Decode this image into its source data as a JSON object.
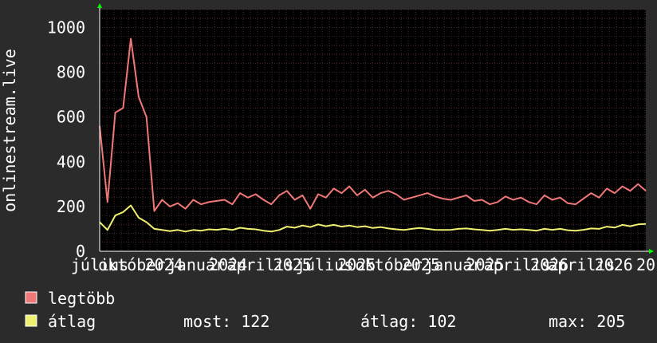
{
  "chart_data": {
    "type": "line",
    "ylabel": "onlinestream.live",
    "ylim": [
      0,
      1080
    ],
    "yticks": [
      0,
      200,
      400,
      600,
      800,
      1000
    ],
    "xticks": [
      "július",
      "október",
      "2024",
      "január",
      "2024",
      "április",
      "2025",
      "július",
      "2025",
      "október",
      "2025",
      "január",
      "2025",
      "április",
      "2026",
      "április",
      "2026",
      "20"
    ],
    "grid": true,
    "legend_placement": "bottom-left",
    "series": [
      {
        "name": "legtöbb",
        "color": "#f07878",
        "values": [
          560,
          220,
          620,
          640,
          950,
          690,
          600,
          180,
          230,
          200,
          215,
          190,
          230,
          210,
          220,
          225,
          230,
          210,
          260,
          240,
          255,
          230,
          210,
          250,
          270,
          230,
          250,
          190,
          255,
          240,
          280,
          260,
          290,
          250,
          275,
          240,
          260,
          270,
          255,
          230,
          240,
          250,
          260,
          245,
          235,
          230,
          240,
          250,
          225,
          230,
          210,
          220,
          245,
          230,
          240,
          220,
          210,
          250,
          230,
          240,
          215,
          210,
          235,
          260,
          240,
          280,
          260,
          290,
          270,
          300,
          270
        ]
      },
      {
        "name": "átlag",
        "color": "#f0f070",
        "values": [
          130,
          95,
          160,
          175,
          205,
          150,
          130,
          100,
          95,
          90,
          95,
          88,
          95,
          92,
          98,
          96,
          100,
          95,
          105,
          100,
          98,
          92,
          88,
          95,
          110,
          105,
          115,
          108,
          120,
          112,
          118,
          110,
          115,
          108,
          112,
          104,
          108,
          102,
          98,
          95,
          100,
          104,
          100,
          96,
          95,
          96,
          100,
          102,
          98,
          95,
          92,
          95,
          100,
          96,
          98,
          95,
          92,
          100,
          96,
          100,
          94,
          92,
          96,
          102,
          100,
          110,
          106,
          118,
          112,
          120,
          122
        ]
      }
    ]
  },
  "legend": [
    {
      "label": "legtöbb",
      "color": "#f07878"
    },
    {
      "label": "átlag",
      "color": "#f0f070"
    }
  ],
  "stats": {
    "most": "most: 122",
    "atlag": "átlag: 102",
    "max": "max: 205"
  },
  "colors": {
    "background": "#2b2b2b",
    "plot_bg": "#000000",
    "grid": "#4a2a2a",
    "axis": "#ffffff",
    "text": "#ffffff",
    "arrow": "#00ff00"
  }
}
